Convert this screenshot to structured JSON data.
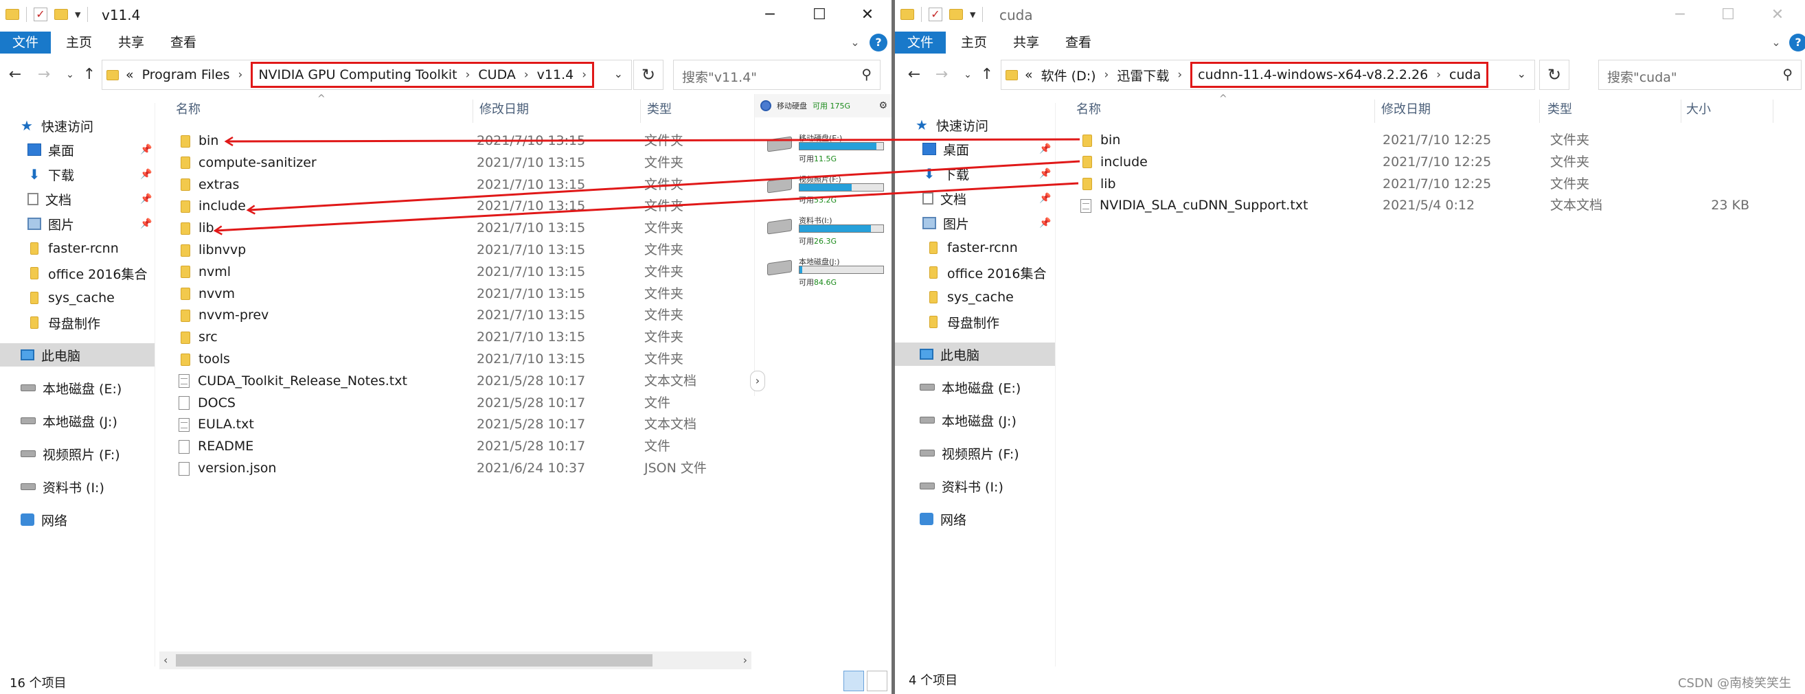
{
  "left": {
    "title": "v11.4",
    "ribbon_tabs": [
      "文件",
      "主页",
      "共享",
      "查看"
    ],
    "breadcrumb_prefix": "«",
    "breadcrumb_plain": [
      "Program Files"
    ],
    "breadcrumb_highlighted": [
      "NVIDIA GPU Computing Toolkit",
      "CUDA",
      "v11.4"
    ],
    "search_placeholder": "搜索\"v11.4\"",
    "columns": [
      "名称",
      "修改日期",
      "类型"
    ],
    "files": [
      {
        "name": "bin",
        "date": "2021/7/10 13:15",
        "type": "文件夹",
        "kind": "folder"
      },
      {
        "name": "compute-sanitizer",
        "date": "2021/7/10 13:15",
        "type": "文件夹",
        "kind": "folder"
      },
      {
        "name": "extras",
        "date": "2021/7/10 13:15",
        "type": "文件夹",
        "kind": "folder"
      },
      {
        "name": "include",
        "date": "2021/7/10 13:15",
        "type": "文件夹",
        "kind": "folder"
      },
      {
        "name": "lib",
        "date": "2021/7/10 13:15",
        "type": "文件夹",
        "kind": "folder"
      },
      {
        "name": "libnvvp",
        "date": "2021/7/10 13:15",
        "type": "文件夹",
        "kind": "folder"
      },
      {
        "name": "nvml",
        "date": "2021/7/10 13:15",
        "type": "文件夹",
        "kind": "folder"
      },
      {
        "name": "nvvm",
        "date": "2021/7/10 13:15",
        "type": "文件夹",
        "kind": "folder"
      },
      {
        "name": "nvvm-prev",
        "date": "2021/7/10 13:15",
        "type": "文件夹",
        "kind": "folder"
      },
      {
        "name": "src",
        "date": "2021/7/10 13:15",
        "type": "文件夹",
        "kind": "folder"
      },
      {
        "name": "tools",
        "date": "2021/7/10 13:15",
        "type": "文件夹",
        "kind": "folder"
      },
      {
        "name": "CUDA_Toolkit_Release_Notes.txt",
        "date": "2021/5/28 10:17",
        "type": "文本文档",
        "kind": "txt"
      },
      {
        "name": "DOCS",
        "date": "2021/5/28 10:17",
        "type": "文件",
        "kind": "file"
      },
      {
        "name": "EULA.txt",
        "date": "2021/5/28 10:17",
        "type": "文本文档",
        "kind": "txt"
      },
      {
        "name": "README",
        "date": "2021/5/28 10:17",
        "type": "文件",
        "kind": "file"
      },
      {
        "name": "version.json",
        "date": "2021/6/24 10:37",
        "type": "JSON 文件",
        "kind": "file"
      }
    ],
    "status": "16 个项目",
    "drive_panel": {
      "header_label": "移动硬盘",
      "header_free": "可用 175G",
      "drives": [
        {
          "label": "移动硬盘(E:)",
          "free_prefix": "可用",
          "free": "11.5G",
          "fill": 0.92
        },
        {
          "label": "视频照片(F:)",
          "free_prefix": "可用",
          "free": "53.2G",
          "fill": 0.62
        },
        {
          "label": "资料书(I:)",
          "free_prefix": "可用",
          "free": "26.3G",
          "fill": 0.85
        },
        {
          "label": "本地磁盘(J:)",
          "free_prefix": "可用",
          "free": "84.6G",
          "fill": 0.03
        }
      ]
    }
  },
  "right": {
    "title": "cuda",
    "ribbon_tabs": [
      "文件",
      "主页",
      "共享",
      "查看"
    ],
    "breadcrumb_prefix": "«",
    "breadcrumb_plain": [
      "软件 (D:)",
      "迅雷下载"
    ],
    "breadcrumb_highlighted": [
      "cudnn-11.4-windows-x64-v8.2.2.26",
      "cuda"
    ],
    "search_placeholder": "搜索\"cuda\"",
    "columns": [
      "名称",
      "修改日期",
      "类型",
      "大小"
    ],
    "files": [
      {
        "name": "bin",
        "date": "2021/7/10 12:25",
        "type": "文件夹",
        "size": "",
        "kind": "folder"
      },
      {
        "name": "include",
        "date": "2021/7/10 12:25",
        "type": "文件夹",
        "size": "",
        "kind": "folder"
      },
      {
        "name": "lib",
        "date": "2021/7/10 12:25",
        "type": "文件夹",
        "size": "",
        "kind": "folder"
      },
      {
        "name": "NVIDIA_SLA_cuDNN_Support.txt",
        "date": "2021/5/4 0:12",
        "type": "文本文档",
        "size": "23 KB",
        "kind": "txt"
      }
    ],
    "status": "4 个项目"
  },
  "nav": {
    "quick_access": "快速访问",
    "pinned": [
      "桌面",
      "下载",
      "文档",
      "图片"
    ],
    "folders": [
      "faster-rcnn",
      "office 2016集合",
      "sys_cache",
      "母盘制作"
    ],
    "this_pc": "此电脑",
    "drives": [
      "本地磁盘 (E:)",
      "本地磁盘 (J:)",
      "视频照片 (F:)",
      "资料书 (I:)"
    ],
    "network": "网络"
  },
  "watermark": "CSDN @南棱笑笑生",
  "colors": {
    "accent": "#1979ca",
    "highlight_box": "#e01818",
    "arrow": "#e01818"
  }
}
